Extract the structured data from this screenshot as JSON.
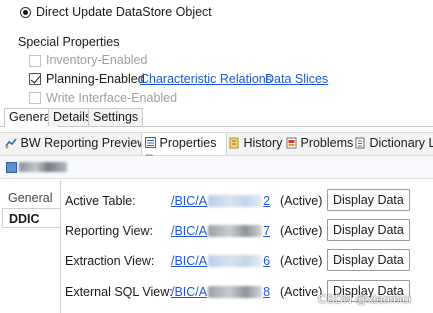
{
  "datastore": {
    "radio_label": "Direct Update DataStore Object"
  },
  "special": {
    "heading": "Special Properties",
    "inventory": "Inventory-Enabled",
    "planning": "Planning-Enabled",
    "char_relations": "Characteristic Relations",
    "data_slices": "Data Slices",
    "write_interface": "Write Interface-Enabled"
  },
  "bottom_tabs": [
    "General",
    "Details",
    "Settings"
  ],
  "view_tabs": {
    "bw_preview": "BW Reporting Preview",
    "properties": "Properties",
    "properties_close": "⊠",
    "history": "History",
    "problems": "Problems",
    "dictionary": "Dictionary Lo"
  },
  "side_tabs": {
    "general": "General",
    "ddic": "DDIC"
  },
  "ddic_rows": [
    {
      "label": "Active Table:",
      "link_prefix": "/BIC/A",
      "link_suffix": "2",
      "status": "(Active)",
      "button": "Display Data"
    },
    {
      "label": "Reporting View:",
      "link_prefix": "/BIC/A",
      "link_suffix": "7",
      "status": "(Active)",
      "button": "Display Data"
    },
    {
      "label": "Extraction View:",
      "link_prefix": "/BIC/A",
      "link_suffix": "6",
      "status": "(Active)",
      "button": "Display Data"
    },
    {
      "label": "External SQL View:",
      "link_prefix": "/BIC/A",
      "link_suffix": "8",
      "status": "(Active)",
      "button": "Display Data"
    }
  ],
  "watermark": "CSDN @xiaomici",
  "colors": {
    "link": "#1f56d8",
    "tab_bg": "#f3f3f3",
    "selection": "#dce6f4"
  }
}
